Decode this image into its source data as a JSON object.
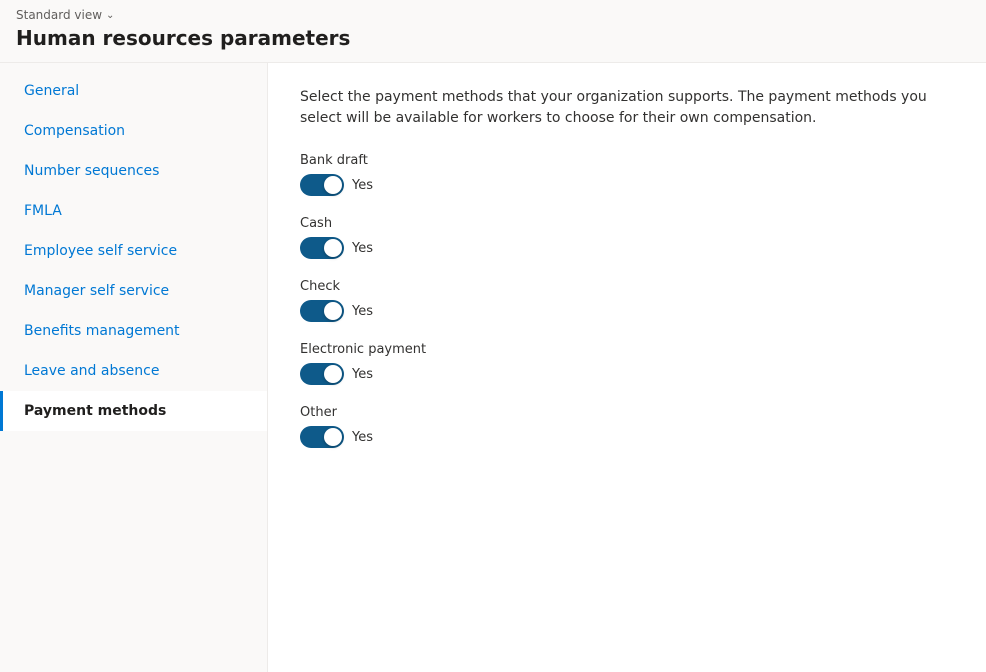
{
  "header": {
    "standard_view_label": "Standard view",
    "page_title": "Human resources parameters"
  },
  "sidebar": {
    "items": [
      {
        "id": "general",
        "label": "General",
        "active": false
      },
      {
        "id": "compensation",
        "label": "Compensation",
        "active": false
      },
      {
        "id": "number-sequences",
        "label": "Number sequences",
        "active": false
      },
      {
        "id": "fmla",
        "label": "FMLA",
        "active": false
      },
      {
        "id": "employee-self-service",
        "label": "Employee self service",
        "active": false
      },
      {
        "id": "manager-self-service",
        "label": "Manager self service",
        "active": false
      },
      {
        "id": "benefits-management",
        "label": "Benefits management",
        "active": false
      },
      {
        "id": "leave-and-absence",
        "label": "Leave and absence",
        "active": false
      },
      {
        "id": "payment-methods",
        "label": "Payment methods",
        "active": true
      }
    ]
  },
  "main": {
    "description": "Select the payment methods that your organization supports. The payment methods you select will be available for workers to choose for their own compensation.",
    "payment_methods": [
      {
        "id": "bank-draft",
        "label": "Bank draft",
        "enabled": true,
        "value": "Yes"
      },
      {
        "id": "cash",
        "label": "Cash",
        "enabled": true,
        "value": "Yes"
      },
      {
        "id": "check",
        "label": "Check",
        "enabled": true,
        "value": "Yes"
      },
      {
        "id": "electronic-payment",
        "label": "Electronic payment",
        "enabled": true,
        "value": "Yes"
      },
      {
        "id": "other",
        "label": "Other",
        "enabled": true,
        "value": "Yes"
      }
    ]
  }
}
